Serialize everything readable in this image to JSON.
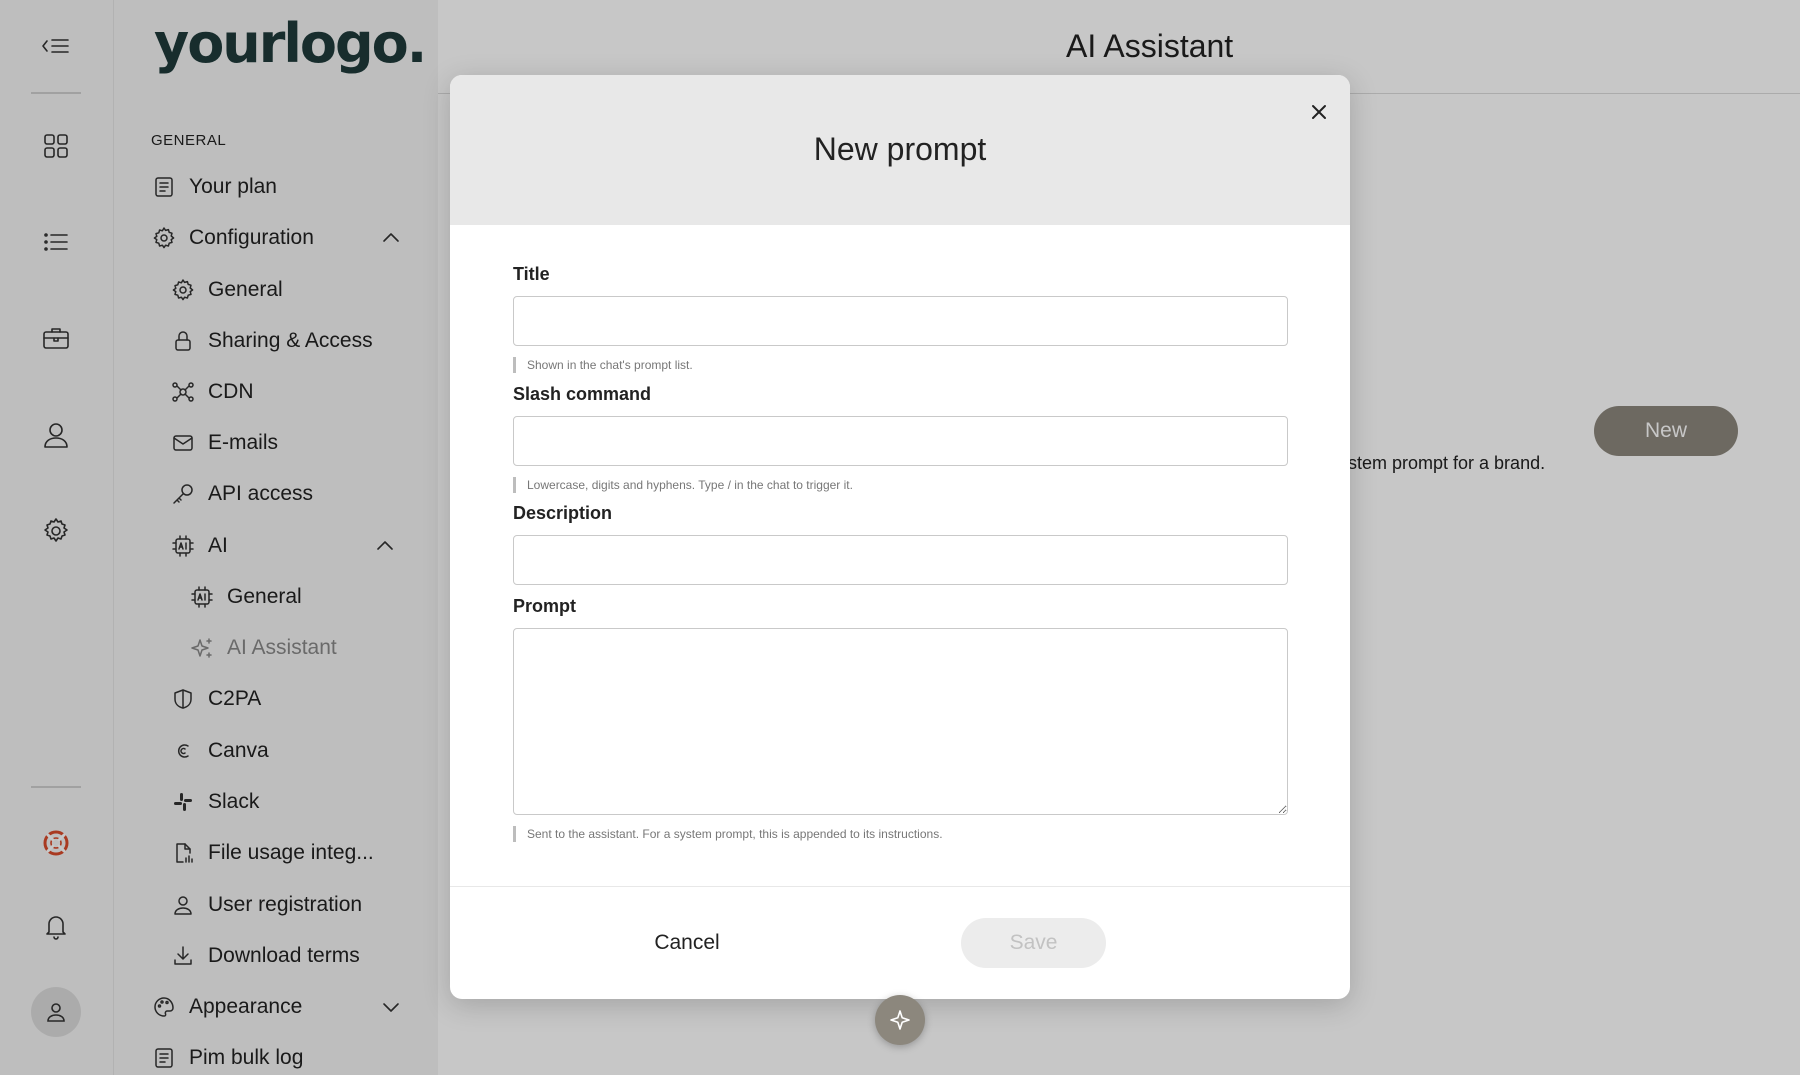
{
  "sidebar": {
    "logo": "yourlogo.",
    "section_label": "GENERAL",
    "items": [
      {
        "label": "Your plan"
      },
      {
        "label": "Configuration"
      },
      {
        "label": "General"
      },
      {
        "label": "Sharing & Access"
      },
      {
        "label": "CDN"
      },
      {
        "label": "E-mails"
      },
      {
        "label": "API access"
      },
      {
        "label": "AI"
      },
      {
        "label": "General"
      },
      {
        "label": "AI Assistant"
      },
      {
        "label": "C2PA"
      },
      {
        "label": "Canva"
      },
      {
        "label": "Slack"
      },
      {
        "label": "File usage integ..."
      },
      {
        "label": "User registration"
      },
      {
        "label": "Download terms"
      },
      {
        "label": "Appearance"
      },
      {
        "label": "Pim bulk log"
      }
    ]
  },
  "main": {
    "title": "AI Assistant",
    "new_label": "New",
    "description_fragment": "stem prompt for a brand."
  },
  "modal": {
    "title": "New prompt",
    "fields": {
      "title": {
        "label": "Title",
        "value": "",
        "hint": "Shown in the chat's prompt list."
      },
      "slash": {
        "label": "Slash command",
        "value": "",
        "hint": "Lowercase, digits and hyphens. Type / in the chat to trigger it."
      },
      "description": {
        "label": "Description",
        "value": ""
      },
      "prompt": {
        "label": "Prompt",
        "value": "",
        "hint": "Sent to the assistant. For a system prompt, this is appended to its instructions."
      }
    },
    "cancel_label": "Cancel",
    "save_label": "Save"
  },
  "colors": {
    "accent": "#8c877d",
    "help_icon": "#d94b2b"
  }
}
